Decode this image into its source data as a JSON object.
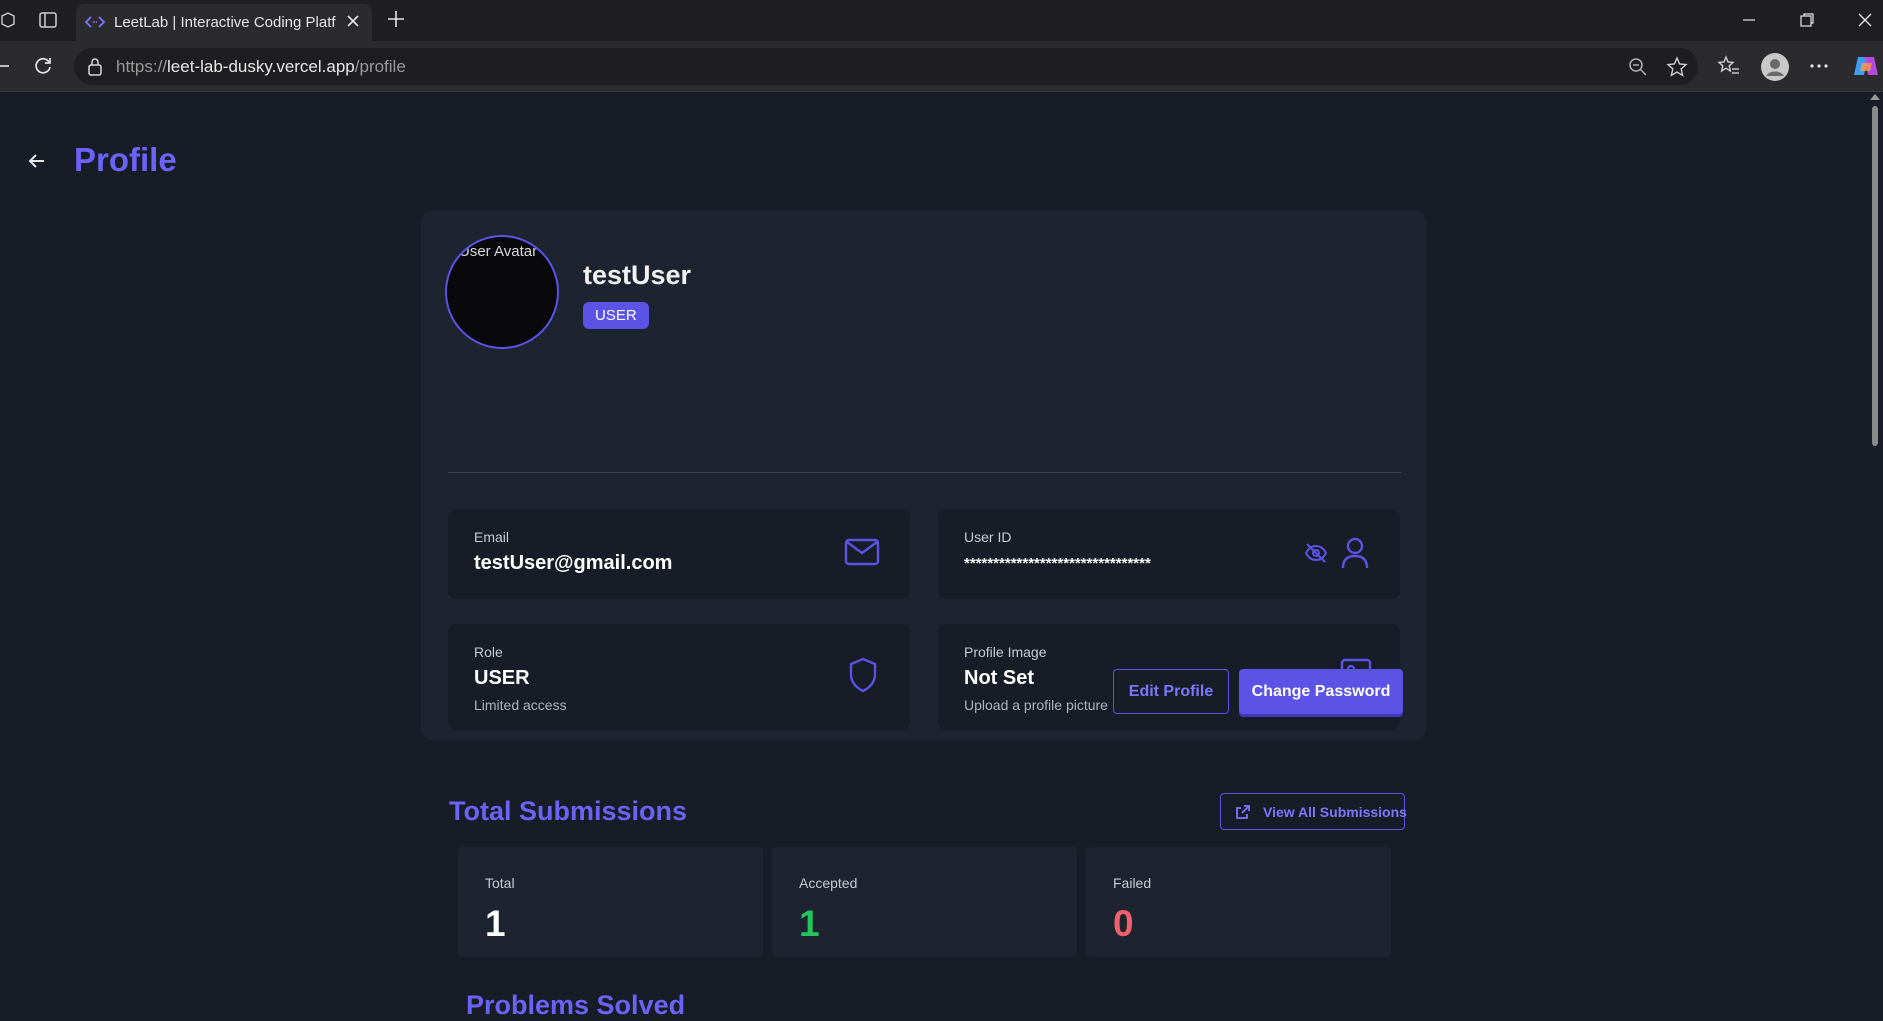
{
  "browser": {
    "tab_title": "LeetLab | Interactive Coding Platform",
    "url_prefix": "https://",
    "url_host": "leet-lab-dusky.vercel.app",
    "url_path": "/profile"
  },
  "page": {
    "title": "Profile"
  },
  "profile": {
    "avatar_alt": "User Avatar",
    "username": "testUser",
    "role_badge": "USER",
    "email": {
      "label": "Email",
      "value": "testUser@gmail.com"
    },
    "user_id": {
      "label": "User ID",
      "value": "********************************"
    },
    "role": {
      "label": "Role",
      "value": "USER",
      "sub": "Limited access"
    },
    "image": {
      "label": "Profile Image",
      "value": "Not Set",
      "sub": "Upload a profile picture"
    },
    "edit_label": "Edit Profile",
    "change_password_label": "Change Password"
  },
  "submissions": {
    "title": "Total Submissions",
    "view_all_label": "View All Submissions",
    "stats": [
      {
        "label": "Total",
        "value": "1",
        "color": "#ffffff"
      },
      {
        "label": "Accepted",
        "value": "1",
        "color": "#22c55e"
      },
      {
        "label": "Failed",
        "value": "0",
        "color": "#f25f6d"
      }
    ]
  },
  "next_section": {
    "title": "Problems Solved"
  },
  "colors": {
    "accent": "#5b52e6",
    "accent_text": "#6b63f6",
    "background": "#181c27",
    "card": "#1d232f"
  }
}
